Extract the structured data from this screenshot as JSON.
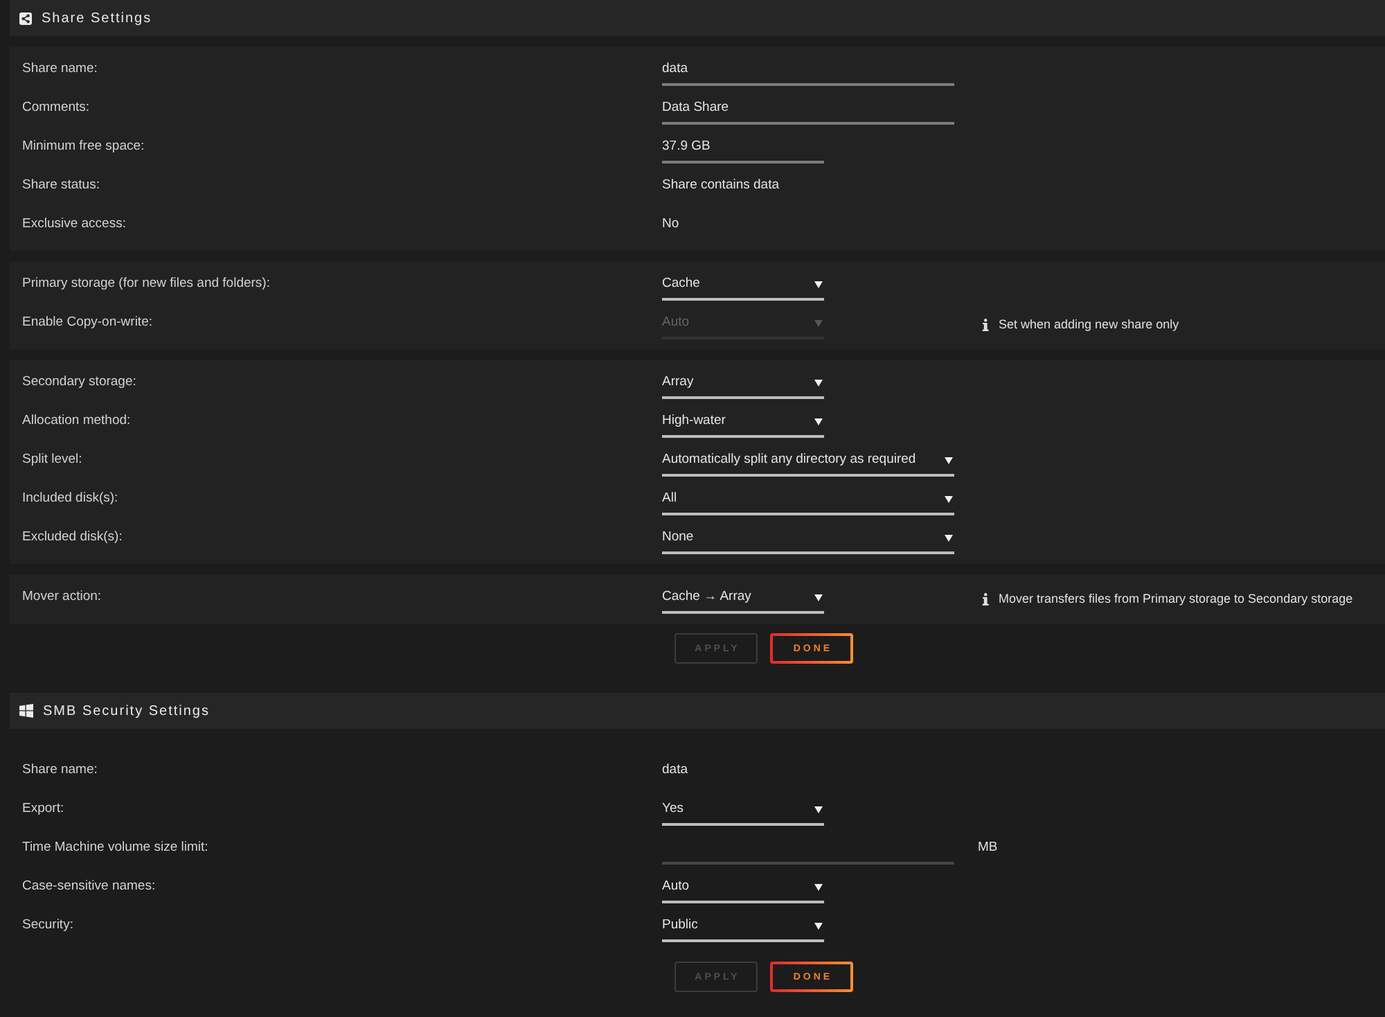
{
  "sections": [
    {
      "kind": "share",
      "title": "Share Settings",
      "groups": [
        {
          "rows": [
            {
              "label": "Share name:",
              "kind": "input",
              "value": "data",
              "disabled": false
            },
            {
              "label": "Comments:",
              "kind": "input",
              "value": "Data Share",
              "disabled": false
            },
            {
              "label": "Minimum free space:",
              "kind": "input",
              "value": "37.9 GB",
              "disabled": false
            },
            {
              "label": "Share status:",
              "kind": "text",
              "value": "Share contains data",
              "disabled": false
            },
            {
              "label": "Exclusive access:",
              "kind": "text",
              "value": "No",
              "disabled": false
            }
          ]
        },
        {
          "rows": [
            {
              "label": "Primary storage (for new files and folders):",
              "kind": "select",
              "value": "Cache",
              "disabled": false
            },
            {
              "label": "Enable Copy-on-write:",
              "kind": "select",
              "value": "Auto",
              "disabled": true,
              "note": "Set when adding new share only"
            }
          ]
        },
        {
          "rows": [
            {
              "label": "Secondary storage:",
              "kind": "select",
              "value": "Array",
              "disabled": false
            },
            {
              "label": "Allocation method:",
              "kind": "select",
              "value": "High-water",
              "disabled": false
            },
            {
              "label": "Split level:",
              "kind": "select",
              "value": "Automatically split any directory as required",
              "disabled": false
            },
            {
              "label": "Included disk(s):",
              "kind": "select",
              "value": "All",
              "disabled": false
            },
            {
              "label": "Excluded disk(s):",
              "kind": "select",
              "value": "None",
              "disabled": false
            }
          ]
        },
        {
          "rows": [
            {
              "label": "Mover action:",
              "kind": "select",
              "value": "Cache → Array",
              "disabled": false,
              "note": "Mover transfers files from Primary storage to Secondary storage"
            }
          ]
        }
      ],
      "buttons": [
        {
          "label": "APPLY",
          "disabled": true
        },
        {
          "label": "DONE",
          "disabled": false
        }
      ]
    },
    {
      "kind": "smb",
      "title": "SMB Security Settings",
      "rows": [
        {
          "label": "Share name:",
          "kind": "text",
          "value": "data",
          "disabled": false
        },
        {
          "label": "Export:",
          "kind": "select",
          "value": "Yes",
          "disabled": false
        },
        {
          "label": "Time Machine volume size limit:",
          "kind": "input",
          "unit": "MB",
          "disabled": false
        },
        {
          "label": "Case-sensitive names:",
          "kind": "select",
          "value": "Auto",
          "disabled": false
        },
        {
          "label": "Security:",
          "kind": "select",
          "value": "Public",
          "disabled": false
        }
      ],
      "buttons": [
        {
          "label": "APPLY",
          "disabled": true
        },
        {
          "label": "DONE",
          "disabled": false
        }
      ]
    }
  ]
}
